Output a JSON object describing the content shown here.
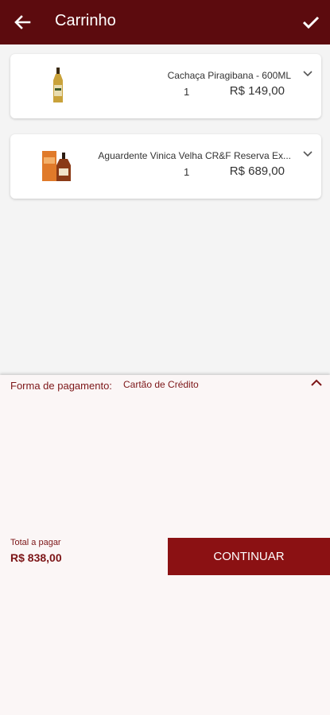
{
  "header": {
    "title": "Carrinho",
    "back_icon": "arrow-left-icon",
    "confirm_icon": "check-icon",
    "color": "#5c0b0e"
  },
  "cart": {
    "items": [
      {
        "name": "Cachaça Piragibana - 600ML",
        "quantity": "1",
        "price": "R$ 149,00",
        "image": "cachaca-bottle"
      },
      {
        "name": "Aguardente Vinica Velha CR&F Reserva Ex...",
        "quantity": "1",
        "price": "R$ 689,00",
        "image": "aguardente-bottle-box"
      }
    ]
  },
  "payment": {
    "label": "Forma de pagamento:",
    "method": "Cartão de Crédito",
    "toggle_icon": "chevron-up-icon"
  },
  "summary": {
    "total_label": "Total a pagar",
    "total_value": "R$ 838,00",
    "continue_label": "CONTINUAR",
    "accent_color": "#8b1113"
  }
}
